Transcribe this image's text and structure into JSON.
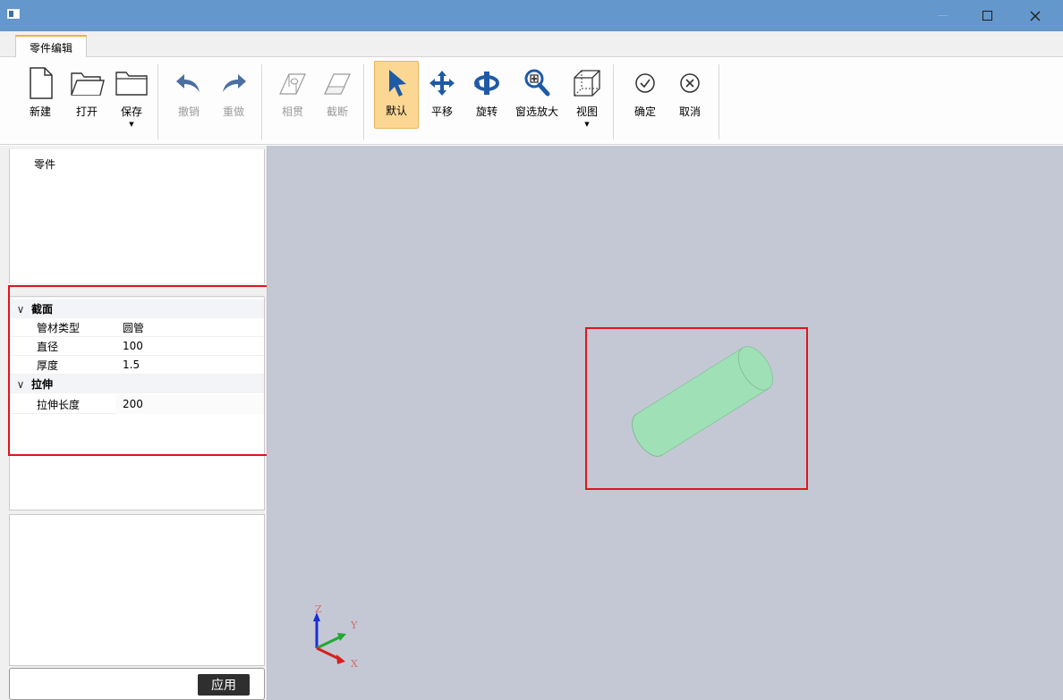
{
  "titlebar": {
    "icons": [
      "app-icon",
      "minimize-icon",
      "maximize-icon",
      "close-icon"
    ]
  },
  "tabs": [
    {
      "label": "零件编辑",
      "active": true
    }
  ],
  "toolbar": {
    "new": "新建",
    "open": "打开",
    "save": "保存",
    "undo": "撤销",
    "redo": "重做",
    "intersect": "相贯",
    "cut": "截断",
    "default": "默认",
    "pan": "平移",
    "rotate": "旋转",
    "zoom_window": "窗选放大",
    "view": "视图",
    "confirm": "确定",
    "cancel": "取消"
  },
  "tree": {
    "root": "零件"
  },
  "properties": {
    "section": {
      "title": "截面",
      "rows": [
        {
          "name": "管材类型",
          "value": "圆管"
        },
        {
          "name": "直径",
          "value": "100"
        },
        {
          "name": "厚度",
          "value": "1.5"
        }
      ]
    },
    "extrude": {
      "title": "拉伸",
      "rows": [
        {
          "name": "拉伸长度",
          "value": "200"
        }
      ]
    }
  },
  "bottom": {
    "apply": "应用"
  },
  "viewport": {
    "axes": {
      "z": "Z",
      "y": "Y",
      "x": "X"
    },
    "colors": {
      "background": "#c4c8d4",
      "tube": "#9fe0b6",
      "axis_x": "#d42020",
      "axis_y": "#22a832",
      "axis_z": "#1a2fd6"
    }
  },
  "highlight_color": "#e0141e"
}
